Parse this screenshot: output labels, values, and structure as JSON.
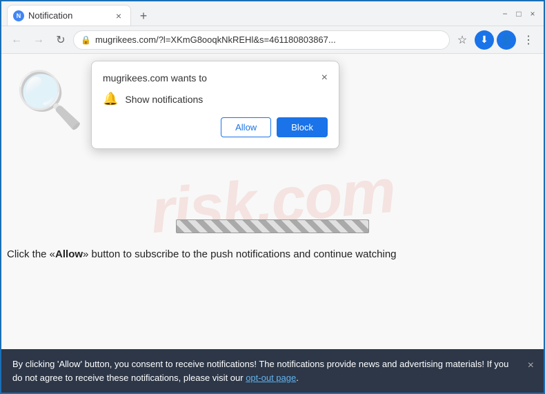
{
  "browser": {
    "tab": {
      "favicon_label": "N",
      "title": "Notification",
      "close_symbol": "×"
    },
    "new_tab_symbol": "+",
    "window_controls": {
      "minimize": "−",
      "maximize": "□",
      "close": "×"
    },
    "toolbar": {
      "back_symbol": "←",
      "forward_symbol": "→",
      "refresh_symbol": "↻",
      "address": "mugrikees.com/?l=XKmG8ooqkNkREHl&s=461180803867...",
      "star_symbol": "☆",
      "profile_symbol": "👤",
      "menu_symbol": "⋮",
      "download_symbol": "⬇"
    }
  },
  "notification_popup": {
    "title": "mugrikees.com wants to",
    "close_symbol": "×",
    "permission_icon": "🔔",
    "permission_text": "Show notifications",
    "allow_label": "Allow",
    "block_label": "Block"
  },
  "watermark": {
    "text": "risk.com"
  },
  "instruction": {
    "text": "Click the «Allow» button to subscribe to the push notifications and continue watching"
  },
  "banner": {
    "text_before_link": "By clicking 'Allow' button, you consent to receive notifications! The notifications provide news and advertising materials! If you do not agree to receive these notifications, please visit our ",
    "link_text": "opt-out page",
    "text_after_link": ".",
    "close_symbol": "×"
  }
}
